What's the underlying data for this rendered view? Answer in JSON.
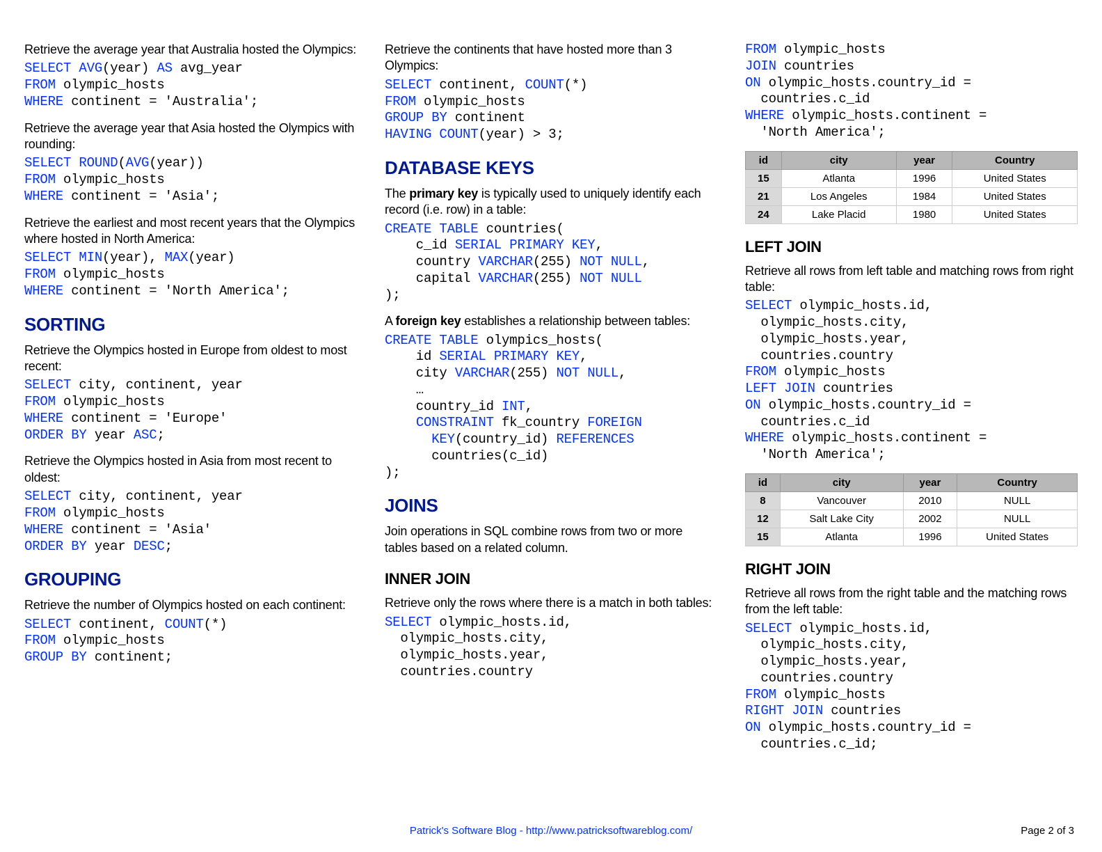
{
  "col1": {
    "block1": {
      "desc": "Retrieve the average year that Australia hosted the Olympics:"
    },
    "block2": {
      "desc": "Retrieve the average year that Asia hosted the Olympics with rounding:"
    },
    "block3": {
      "desc": "Retrieve the earliest and most recent years that the Olympics where hosted in North America:"
    },
    "h_sorting": "SORTING",
    "block4": {
      "desc": "Retrieve the Olympics hosted in Europe from oldest to most recent:"
    },
    "block5": {
      "desc": "Retrieve the Olympics hosted in Asia from most recent to oldest:"
    },
    "h_grouping": "GROUPING",
    "block6": {
      "desc": "Retrieve the number of Olympics hosted on each continent:"
    }
  },
  "col2": {
    "block1": {
      "desc": "Retrieve the continents that have hosted more than 3 Olympics:"
    },
    "h_dbkeys": "DATABASE KEYS",
    "pk_desc_a": "The ",
    "pk_desc_b": "primary key",
    "pk_desc_c": " is typically used to uniquely identify each record (i.e. row) in a table:",
    "fk_desc_a": "A ",
    "fk_desc_b": "foreign key",
    "fk_desc_c": " establishes a relationship between tables:",
    "h_joins": "JOINS",
    "joins_desc": "Join operations in SQL combine rows from two or more tables based on a related column.",
    "h_inner": "INNER JOIN",
    "inner_desc": "Retrieve only the rows where there is a match in both tables:"
  },
  "col3": {
    "table1": {
      "headers": [
        "id",
        "city",
        "year",
        "Country"
      ],
      "rows": [
        [
          "15",
          "Atlanta",
          "1996",
          "United States"
        ],
        [
          "21",
          "Los Angeles",
          "1984",
          "United States"
        ],
        [
          "24",
          "Lake Placid",
          "1980",
          "United States"
        ]
      ]
    },
    "h_left": "LEFT JOIN",
    "left_desc": "Retrieve all rows from left table and matching rows from right table:",
    "table2": {
      "headers": [
        "id",
        "city",
        "year",
        "Country"
      ],
      "rows": [
        [
          "8",
          "Vancouver",
          "2010",
          "NULL"
        ],
        [
          "12",
          "Salt Lake City",
          "2002",
          "NULL"
        ],
        [
          "15",
          "Atlanta",
          "1996",
          "United States"
        ]
      ]
    },
    "h_right": "RIGHT JOIN",
    "right_desc": "Retrieve all rows from the right table and the matching rows from the left table:"
  },
  "footer": "Patrick's Software Blog - http://www.patricksoftwareblog.com/",
  "page": "Page 2 of 3",
  "chart_data": [
    {
      "type": "table",
      "title": "Inner Join result for North America",
      "columns": [
        "id",
        "city",
        "year",
        "Country"
      ],
      "rows": [
        [
          15,
          "Atlanta",
          1996,
          "United States"
        ],
        [
          21,
          "Los Angeles",
          1984,
          "United States"
        ],
        [
          24,
          "Lake Placid",
          1980,
          "United States"
        ]
      ]
    },
    {
      "type": "table",
      "title": "Left Join result for North America",
      "columns": [
        "id",
        "city",
        "year",
        "Country"
      ],
      "rows": [
        [
          8,
          "Vancouver",
          2010,
          null
        ],
        [
          12,
          "Salt Lake City",
          2002,
          null
        ],
        [
          15,
          "Atlanta",
          1996,
          "United States"
        ]
      ]
    }
  ]
}
